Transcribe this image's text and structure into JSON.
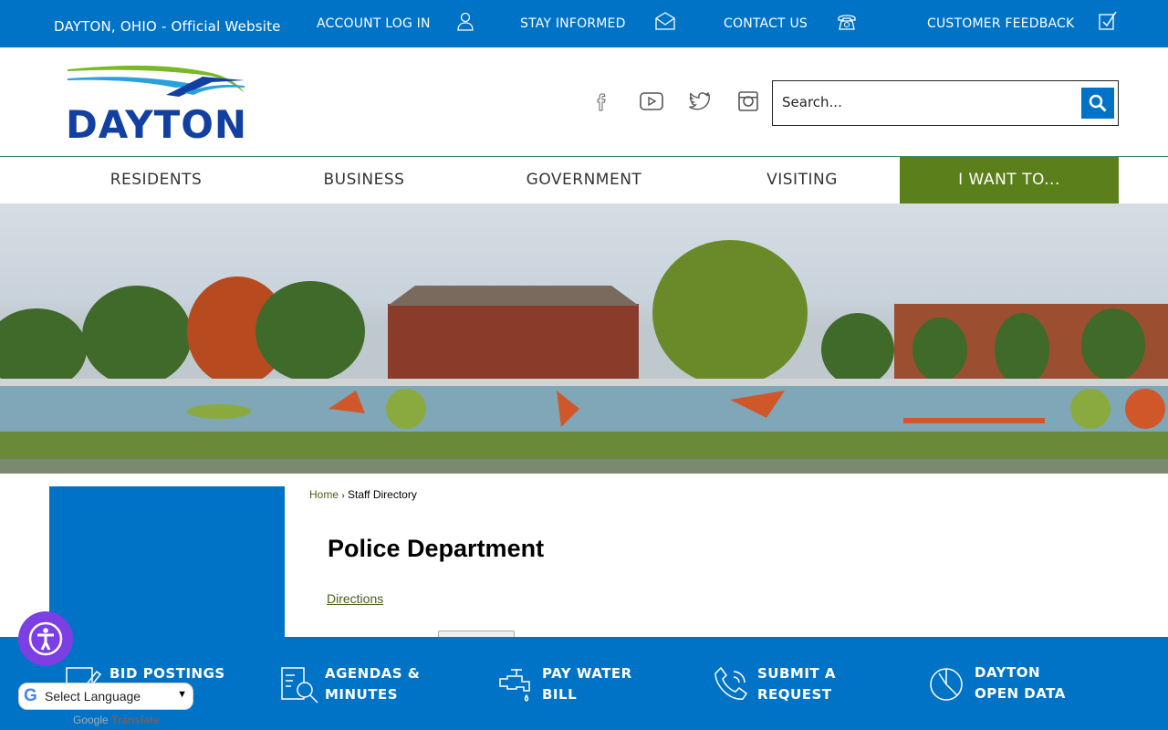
{
  "topbar": {
    "site_title": "DAYTON, OHIO - Official Website",
    "links": [
      {
        "label": "ACCOUNT LOG IN",
        "icon": "user-icon"
      },
      {
        "label": "STAY INFORMED",
        "icon": "envelope-icon"
      },
      {
        "label": "CONTACT US",
        "icon": "phone-icon"
      },
      {
        "label": "CUSTOMER FEEDBACK",
        "icon": "checkbox-icon"
      }
    ]
  },
  "header": {
    "logo_text": "DAYTON",
    "social": [
      "facebook-icon",
      "youtube-icon",
      "twitter-icon",
      "instagram-icon"
    ],
    "search": {
      "placeholder": "Search..."
    }
  },
  "nav": {
    "items": [
      "RESIDENTS",
      "BUSINESS",
      "GOVERNMENT",
      "VISITING",
      "I WANT TO..."
    ]
  },
  "breadcrumb": {
    "home": "Home",
    "separator": "›",
    "current": "Staff Directory"
  },
  "main": {
    "title": "Police Department",
    "directions": "Directions"
  },
  "footer": {
    "items": [
      {
        "line1": "BID POSTINGS",
        "line2": ""
      },
      {
        "line1": "AGENDAS &",
        "line2": "MINUTES"
      },
      {
        "line1": "PAY WATER",
        "line2": "BILL"
      },
      {
        "line1": "SUBMIT A",
        "line2": "REQUEST"
      },
      {
        "line1": "DAYTON",
        "line2": "OPEN DATA"
      }
    ]
  },
  "translate": {
    "select": "Select Language",
    "google": "Google",
    "translate": "Translate"
  },
  "colors": {
    "brand_blue": "#0073c6",
    "accent_green": "#5b7f1a",
    "accessibility_purple": "#7b3fe4"
  }
}
